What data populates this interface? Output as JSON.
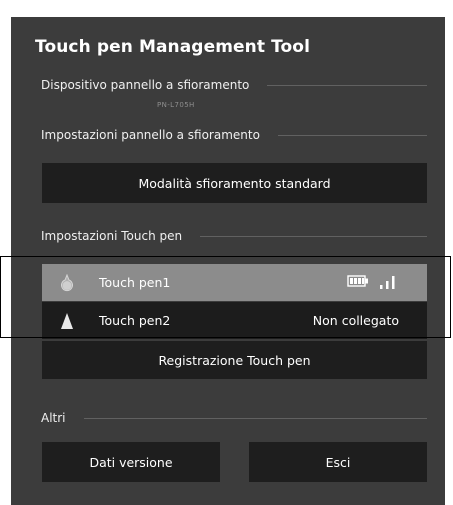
{
  "window": {
    "title": "Touch pen Management Tool"
  },
  "device_section": {
    "label": "Dispositivo pannello a sfioramento",
    "device_name": "PN-L705H"
  },
  "panel_settings_section": {
    "label": "Impostazioni pannello a sfioramento",
    "mode_button": "Modalità sfioramento standard"
  },
  "pen_settings_section": {
    "label": "Impostazioni Touch pen",
    "pens": [
      {
        "name": "Touch pen1",
        "status": "",
        "battery_icon": "battery-icon",
        "signal_icon": "signal-strength-icon"
      },
      {
        "name": "Touch pen2",
        "status": "Non collegato"
      }
    ],
    "register_button": "Registrazione Touch pen"
  },
  "other_section": {
    "label": "Altri",
    "version_button": "Dati versione",
    "exit_button": "Esci"
  },
  "colors": {
    "panel_bg": "#3c3c3c",
    "button_bg": "#1e1e1e",
    "selected_row": "#8c8c8c"
  }
}
